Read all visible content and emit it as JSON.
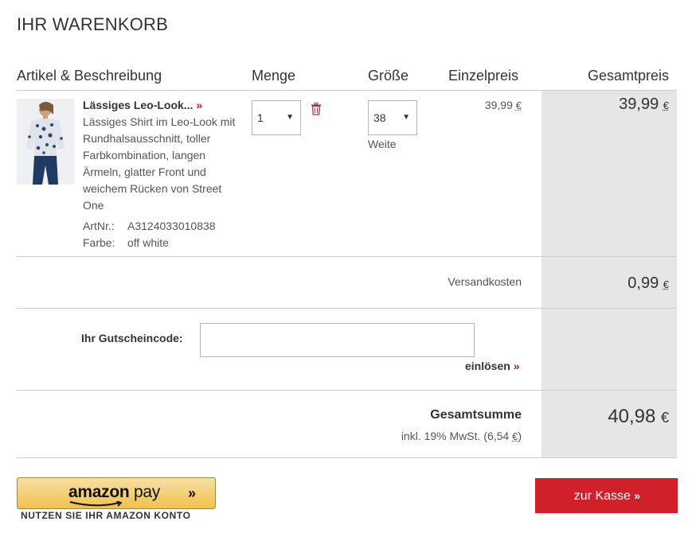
{
  "page": {
    "title": "IHR WARENKORB"
  },
  "table_header": {
    "article": "Artikel & Beschreibung",
    "quantity": "Menge",
    "size": "Größe",
    "unit_price": "Einzelpreis",
    "total_price": "Gesamtpreis"
  },
  "item": {
    "name": "Lässiges Leo-Look...",
    "description": "Lässiges Shirt im Leo-Look mit Rundhalsausschnitt, toller Farbkombination, langen Ärmeln, glatter Front und weichem Rücken von Street One",
    "artnr_label": "ArtNr.:",
    "artnr": "A3124033010838",
    "color_label": "Farbe:",
    "color": "off white",
    "quantity": "1",
    "size": "38",
    "fit": "Weite",
    "unit_price": "39,99",
    "total": "39,99"
  },
  "currency": "€",
  "shipping": {
    "label": "Versandkosten",
    "value": "0,99"
  },
  "coupon": {
    "label": "Ihr Gutscheincode:",
    "value": "",
    "redeem_label": "einlösen"
  },
  "summary": {
    "label": "Gesamtsumme",
    "total": "40,98",
    "vat_prefix": "inkl. 19% MwSt. (6,54",
    "vat_suffix": ")"
  },
  "amazon": {
    "logo_main": "amazon",
    "logo_pay": "pay",
    "subtitle": "NUTZEN SIE IHR AMAZON KONTO"
  },
  "checkout": {
    "label": "zur Kasse"
  },
  "icons": {
    "chevron": "»",
    "trash": "trash-icon"
  },
  "colors": {
    "accent_red": "#d0202a",
    "total_column": "#e6e6e6",
    "amazon_yellow": "#f0c14b"
  }
}
